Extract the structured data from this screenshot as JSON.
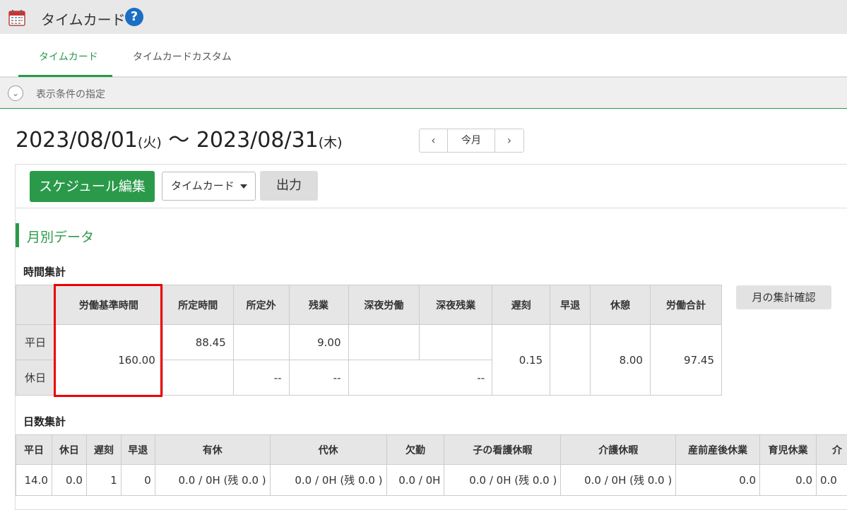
{
  "app": {
    "title": "タイムカード",
    "help": "?"
  },
  "tabs": [
    {
      "label": "タイムカード",
      "active": true
    },
    {
      "label": "タイムカードカスタム",
      "active": false
    }
  ],
  "condition": {
    "label": "表示条件の指定"
  },
  "date_range": {
    "start": "2023/08/01",
    "start_dow": "(火)",
    "sep": " 〜 ",
    "end": "2023/08/31",
    "end_dow": "(木)"
  },
  "nav": {
    "prev": "‹",
    "today": "今月",
    "next": "›"
  },
  "toolbar": {
    "schedule_label": "スケジュール編集",
    "select_value": "タイムカード",
    "output_label": "出力"
  },
  "section": {
    "title": "月別データ"
  },
  "time_summary": {
    "title": "時間集計",
    "headers": [
      "労働基準時間",
      "所定時間",
      "所定外",
      "残業",
      "深夜労働",
      "深夜残業",
      "遅刻",
      "早退",
      "休憩",
      "労働合計"
    ],
    "row_labels": [
      "平日",
      "休日"
    ],
    "standard_hours": "160.00",
    "weekday": {
      "scheduled": "88.45",
      "non_scheduled": "",
      "overtime": "9.00",
      "late_night": "",
      "late_night_overtime": ""
    },
    "holiday": {
      "scheduled": "",
      "non_scheduled": "--",
      "overtime": "--",
      "late_night": "",
      "late_night_overtime": "--"
    },
    "late": "0.15",
    "early_leave": "",
    "break": "8.00",
    "total": "97.45",
    "monthly_button": "月の集計確認"
  },
  "day_summary": {
    "title": "日数集計",
    "headers": [
      "平日",
      "休日",
      "遅刻",
      "早退",
      "有休",
      "代休",
      "欠勤",
      "子の看護休暇",
      "介護休暇",
      "産前産後休業",
      "育児休業",
      "介"
    ],
    "values": [
      "14.0",
      "0.0",
      "1",
      "0",
      "0.0 / 0H (残 0.0 )",
      "0.0 / 0H (残 0.0 )",
      "0.0 / 0H",
      "0.0 / 0H (残 0.0 )",
      "0.0 / 0H (残 0.0 )",
      "0.0",
      "0.0",
      "0.0"
    ]
  },
  "colors": {
    "accent": "#2a9a4a",
    "highlight": "#e00000",
    "help": "#1a6fc4"
  }
}
